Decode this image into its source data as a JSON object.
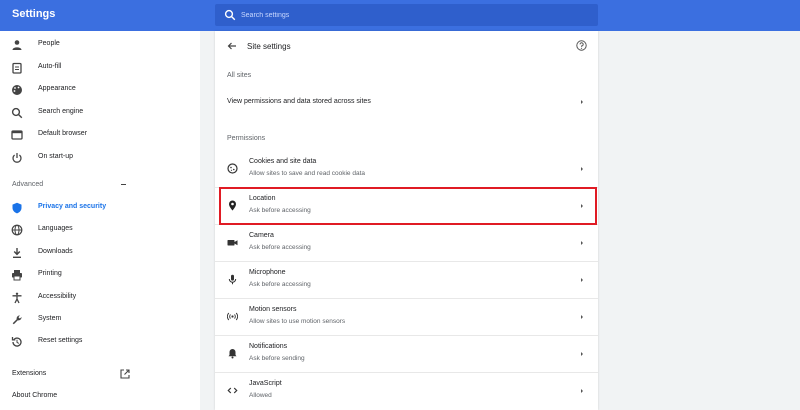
{
  "header": {
    "title": "Settings",
    "search_placeholder": "Search settings",
    "color": "#3b6fe0"
  },
  "sidebar": {
    "items": [
      {
        "label": "People",
        "icon": "person-icon"
      },
      {
        "label": "Auto-fill",
        "icon": "clipboard-icon"
      },
      {
        "label": "Appearance",
        "icon": "palette-icon"
      },
      {
        "label": "Search engine",
        "icon": "search-icon"
      },
      {
        "label": "Default browser",
        "icon": "browser-icon"
      },
      {
        "label": "On start-up",
        "icon": "power-icon"
      }
    ],
    "advanced_label": "Advanced",
    "advanced_items": [
      {
        "label": "Privacy and security",
        "icon": "shield-icon",
        "active": true
      },
      {
        "label": "Languages",
        "icon": "globe-icon"
      },
      {
        "label": "Downloads",
        "icon": "download-icon"
      },
      {
        "label": "Printing",
        "icon": "printer-icon"
      },
      {
        "label": "Accessibility",
        "icon": "accessibility-icon"
      },
      {
        "label": "System",
        "icon": "wrench-icon"
      },
      {
        "label": "Reset settings",
        "icon": "reset-icon"
      }
    ],
    "extensions_label": "Extensions",
    "about_label": "About Chrome",
    "active_color": "#1a73e8"
  },
  "main": {
    "title": "Site settings",
    "all_sites_heading": "All sites",
    "all_sites_link": "View permissions and data stored across sites",
    "permissions_heading": "Permissions",
    "permissions": [
      {
        "title": "Cookies and site data",
        "subtitle": "Allow sites to save and read cookie data",
        "icon": "cookie-icon"
      },
      {
        "title": "Location",
        "subtitle": "Ask before accessing",
        "icon": "location-pin-icon",
        "highlighted": true
      },
      {
        "title": "Camera",
        "subtitle": "Ask before accessing",
        "icon": "camera-icon"
      },
      {
        "title": "Microphone",
        "subtitle": "Ask before accessing",
        "icon": "microphone-icon"
      },
      {
        "title": "Motion sensors",
        "subtitle": "Allow sites to use motion sensors",
        "icon": "motion-sensor-icon"
      },
      {
        "title": "Notifications",
        "subtitle": "Ask before sending",
        "icon": "bell-icon"
      },
      {
        "title": "JavaScript",
        "subtitle": "Allowed",
        "icon": "code-icon"
      }
    ],
    "highlight_color": "#e01b24"
  }
}
